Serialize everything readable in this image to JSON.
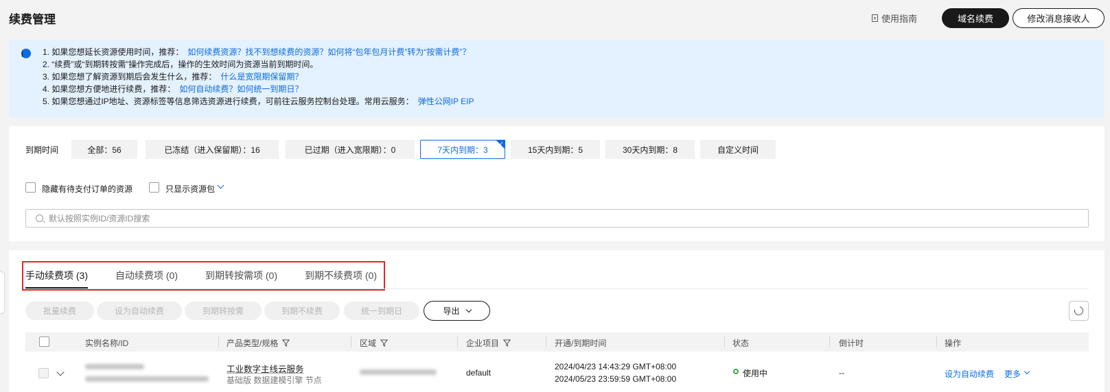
{
  "header": {
    "title": "续费管理",
    "guide_label": "使用指南",
    "domain_renew_label": "域名续费",
    "modify_receiver_label": "修改消息接收人"
  },
  "notice": {
    "lines": [
      {
        "text": "1. 如果您想延长资源使用时间，推荐：",
        "link": "如何续费资源？找不到想续费的资源？如何将“包年包月计费”转为“按需计费”？"
      },
      {
        "text": "2. “续费”或“到期转按需”操作完成后，操作的生效时间为资源当前到期时间。",
        "link": ""
      },
      {
        "text": "3. 如果您想了解资源到期后会发生什么，推荐：",
        "link": "什么是宽限期保留期？"
      },
      {
        "text": "4. 如果您想方便地进行续费，推荐：",
        "link": "如何自动续费？如何统一到期日？"
      },
      {
        "text": "5. 如果您想通过IP地址、资源标签等信息筛选资源进行续费，可前往云服务控制台处理。常用云服务：",
        "link": "弹性公网IP EIP"
      }
    ]
  },
  "filters": {
    "label": "到期时间",
    "items": [
      {
        "label": "全部：56"
      },
      {
        "label": "已冻结（进入保留期）：16"
      },
      {
        "label": "已过期（进入宽限期）：0"
      },
      {
        "label": "7天内到期：3",
        "active": true
      },
      {
        "label": "15天内到期：5"
      },
      {
        "label": "30天内到期：8"
      },
      {
        "label": "自定义时间"
      }
    ],
    "hide_pending_label": "隐藏有待支付订单的资源",
    "only_package_label": "只显示资源包"
  },
  "search": {
    "placeholder": "默认按照实例ID/资源ID搜索",
    "value": ""
  },
  "tabs": [
    {
      "label": "手动续费项 (3)",
      "active": true
    },
    {
      "label": "自动续费项 (0)"
    },
    {
      "label": "到期转按需项 (0)"
    },
    {
      "label": "到期不续费项 (0)"
    }
  ],
  "toolbar": {
    "batch_renew": "批量续费",
    "set_auto_renew": "设为自动续费",
    "to_on_demand": "到期转按需",
    "no_renew": "到期不续费",
    "unify_date": "统一到期日",
    "export": "导出"
  },
  "table": {
    "columns": {
      "name": "实例名称/ID",
      "product": "产品类型/规格",
      "region": "区域",
      "project": "企业项目",
      "time": "开通/到期时间",
      "status": "状态",
      "countdown": "倒计时",
      "actions": "操作"
    },
    "rows": [
      {
        "product_name": "工业数字主线云服务",
        "product_spec": "基础版 数据建模引擎 节点",
        "project": "default",
        "open_time": "2024/04/23 14:43:29 GMT+08:00",
        "expire_time": "2024/05/23 23:59:59 GMT+08:00",
        "status": "使用中",
        "countdown": "--",
        "action_auto": "设为自动续费",
        "action_more": "更多"
      }
    ]
  }
}
